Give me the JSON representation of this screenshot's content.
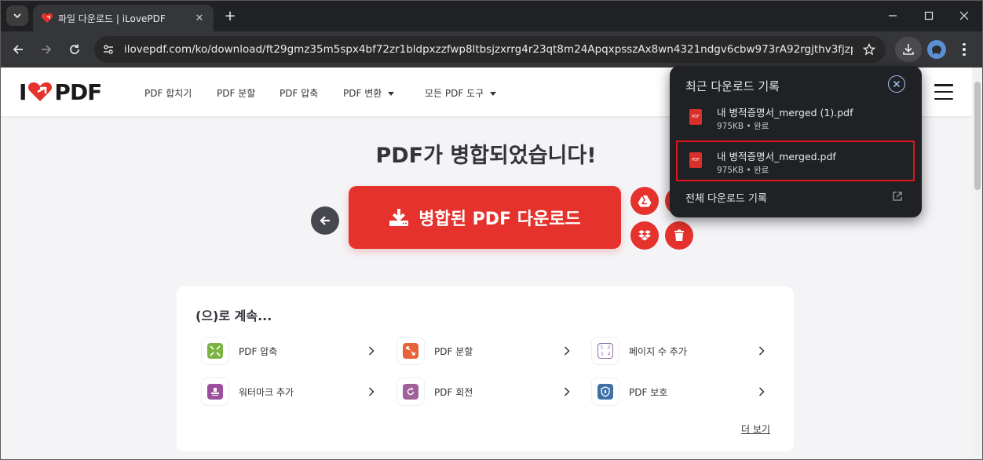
{
  "browser": {
    "tab_title": "파일 다운로드 | iLovePDF",
    "url": "ilovepdf.com/ko/download/ft29gmz35m5spx4bf72zr1bldpxzzfwp8ltbsjzxrrg4r23qt8m24ApqxpsszAx8wn4321ndgv6cbw973rA92rgjthv3fjzp6g1cgs..."
  },
  "site": {
    "logo_left": "I",
    "logo_right": "PDF",
    "nav": [
      "PDF 합치기",
      "PDF 분할",
      "PDF 압축",
      "PDF 변환",
      "모든 PDF 도구"
    ]
  },
  "main": {
    "headline": "PDF가 병합되었습니다!",
    "download_label": "병합된 PDF 다운로드"
  },
  "continue": {
    "title": "(으)로 계속...",
    "tools": [
      {
        "label": "PDF 압축",
        "icon": "compress-icon",
        "color": "#7cb342"
      },
      {
        "label": "PDF 분할",
        "icon": "split-icon",
        "color": "#e8633a"
      },
      {
        "label": "페이지 수 추가",
        "icon": "page-numbers-icon",
        "color": "#8e6fa8"
      },
      {
        "label": "워터마크 추가",
        "icon": "watermark-icon",
        "color": "#9c4f9c"
      },
      {
        "label": "PDF 회전",
        "icon": "rotate-icon",
        "color": "#a0609a"
      },
      {
        "label": "PDF 보호",
        "icon": "protect-icon",
        "color": "#3f6fa5"
      }
    ],
    "more": "더 보기"
  },
  "downloads_popup": {
    "title": "최근 다운로드 기록",
    "items": [
      {
        "name": "내 병적증명서_merged (1).pdf",
        "status": "975KB • 완료"
      },
      {
        "name": "내 병적증명서_merged.pdf",
        "status": "975KB • 완료"
      }
    ],
    "all_label": "전체 다운로드 기록",
    "file_icon_text": "PDF"
  },
  "colors": {
    "brand_red": "#e5322d",
    "chrome_dark": "#202124",
    "highlight_border": "#e0131d"
  }
}
